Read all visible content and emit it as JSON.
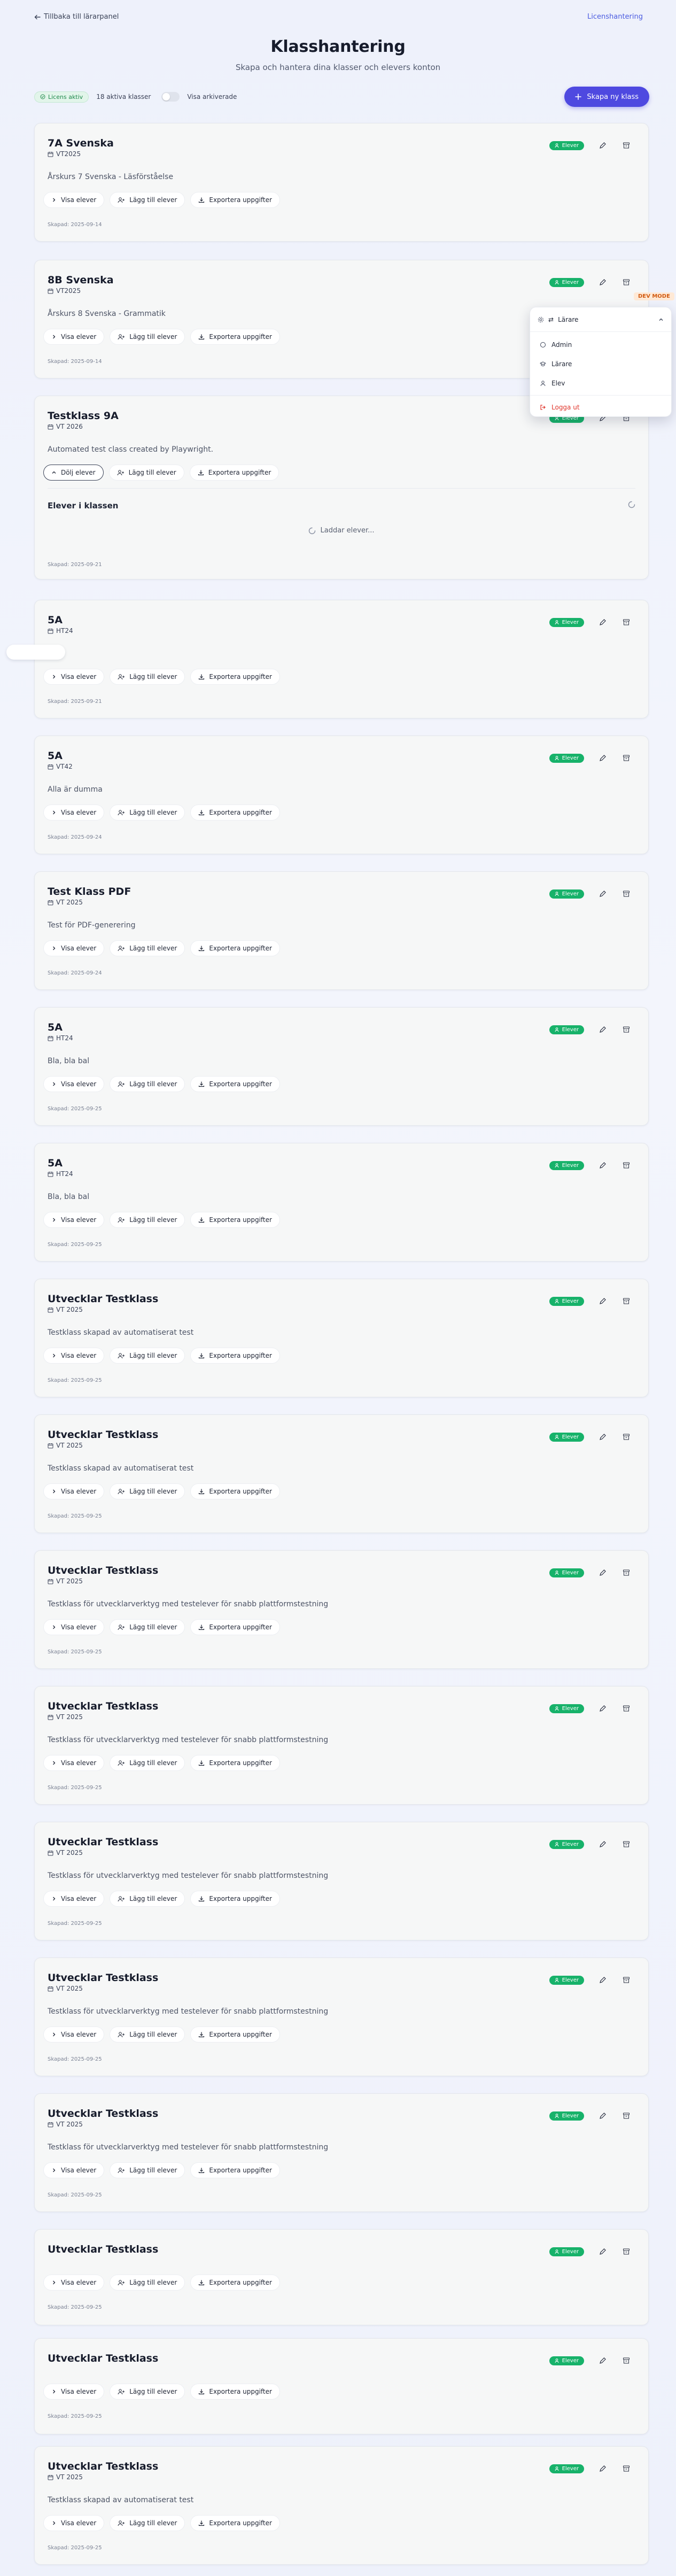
{
  "header": {
    "back_link": "Tillbaka till lärarpanel",
    "top_right": "Licenshantering"
  },
  "hero": {
    "title": "Klasshantering",
    "subtitle": "Skapa och hantera dina klasser och elevers konton"
  },
  "toolbar": {
    "license": "Licens aktiv",
    "active_count": "18 aktiva klasser",
    "show_archived": "Visa arkiverade",
    "create_button": "Skapa ny klass"
  },
  "labels": {
    "students_badge": "Elever",
    "show_students": "Visa elever",
    "hide_students": "Dölj elever",
    "add_student": "Lägg till elever",
    "export": "Exportera uppgifter",
    "students_in_class": "Elever i klassen",
    "loading": "Laddar elever..."
  },
  "dev": {
    "badge": "DEV MODE",
    "current_role": "Lärare",
    "roles": [
      "Admin",
      "Lärare",
      "Elev"
    ],
    "logout": "Logga ut"
  },
  "classes": [
    {
      "title": "7A Svenska",
      "term": "VT2025",
      "description": "Årskurs 7 Svenska - Läsförståelse",
      "created": "Skapad: 2025-09-14"
    },
    {
      "title": "8B Svenska",
      "term": "VT2025",
      "description": "Årskurs 8 Svenska - Grammatik",
      "created": "Skapad: 2025-09-14"
    },
    {
      "title": "Testklass 9A",
      "term": "VT 2026",
      "description": "Automated test class created by Playwright.",
      "created": "Skapad: 2025-09-21",
      "expanded": true
    },
    {
      "title": "5A",
      "term": "HT24",
      "description": "af",
      "created": "Skapad: 2025-09-21"
    },
    {
      "title": "5A",
      "term": "VT42",
      "description": "Alla är dumma",
      "created": "Skapad: 2025-09-24"
    },
    {
      "title": "Test Klass PDF",
      "term": "VT 2025",
      "description": "Test för PDF-generering",
      "created": "Skapad: 2025-09-24"
    },
    {
      "title": "5A",
      "term": "HT24",
      "description": "Bla, bla bal",
      "created": "Skapad: 2025-09-25"
    },
    {
      "title": "5A",
      "term": "HT24",
      "description": "Bla, bla bal",
      "created": "Skapad: 2025-09-25"
    },
    {
      "title": "Utvecklar Testklass",
      "term": "VT 2025",
      "description": "Testklass skapad av automatiserat test",
      "created": "Skapad: 2025-09-25"
    },
    {
      "title": "Utvecklar Testklass",
      "term": "VT 2025",
      "description": "Testklass skapad av automatiserat test",
      "created": "Skapad: 2025-09-25"
    },
    {
      "title": "Utvecklar Testklass",
      "term": "VT 2025",
      "description": "Testklass för utvecklarverktyg med testelever för snabb plattformstestning",
      "created": "Skapad: 2025-09-25"
    },
    {
      "title": "Utvecklar Testklass",
      "term": "VT 2025",
      "description": "Testklass för utvecklarverktyg med testelever för snabb plattformstestning",
      "created": "Skapad: 2025-09-25"
    },
    {
      "title": "Utvecklar Testklass",
      "term": "VT 2025",
      "description": "Testklass för utvecklarverktyg med testelever för snabb plattformstestning",
      "created": "Skapad: 2025-09-25"
    },
    {
      "title": "Utvecklar Testklass",
      "term": "VT 2025",
      "description": "Testklass för utvecklarverktyg med testelever för snabb plattformstestning",
      "created": "Skapad: 2025-09-25"
    },
    {
      "title": "Utvecklar Testklass",
      "term": "VT 2025",
      "description": "Testklass för utvecklarverktyg med testelever för snabb plattformstestning",
      "created": "Skapad: 2025-09-25"
    },
    {
      "title": "Utvecklar Testklass",
      "term": "",
      "description": "",
      "created": "Skapad: 2025-09-25"
    },
    {
      "title": "Utvecklar Testklass",
      "term": "",
      "description": "",
      "created": "Skapad: 2025-09-25"
    },
    {
      "title": "Utvecklar Testklass",
      "term": "VT 2025",
      "description": "Testklass skapad av automatiserat test",
      "created": "Skapad: 2025-09-25"
    }
  ]
}
